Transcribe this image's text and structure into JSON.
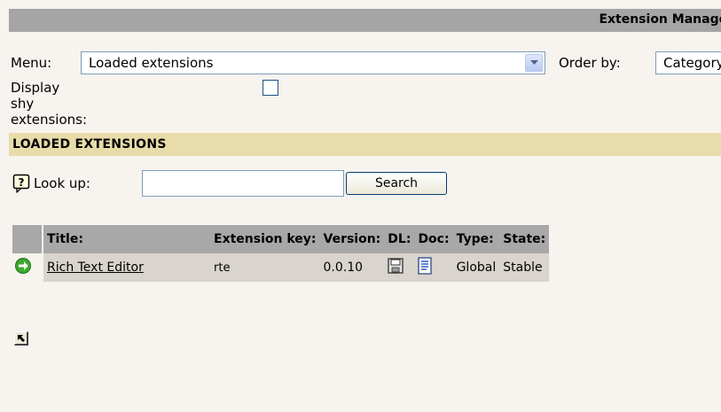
{
  "header": {
    "title": "Extension Manager"
  },
  "menu": {
    "label": "Menu:",
    "selected": "Loaded extensions",
    "order_label": "Order by:",
    "order_selected": "Category"
  },
  "shy": {
    "label": "Display shy extensions:",
    "checked": false
  },
  "section": {
    "title": "LOADED EXTENSIONS"
  },
  "lookup": {
    "label": "Look up:",
    "value": "",
    "search_label": "Search"
  },
  "table": {
    "headers": [
      "Title:",
      "Extension key:",
      "Version:",
      "DL:",
      "Doc:",
      "Type:",
      "State:"
    ],
    "rows": [
      {
        "title": "Rich Text Editor",
        "key": "rte",
        "version": "0.0.10",
        "type": "Global",
        "state": "Stable"
      }
    ]
  },
  "icons": {
    "help": "help-icon",
    "remove": "remove-extension-icon",
    "download": "floppy-disk-icon",
    "doc": "document-icon",
    "goto": "arrow-up-left-icon"
  },
  "colors": {
    "topbar": "#a5a5a5",
    "section_bar": "#e8dcaa",
    "table_head": "#a8a8a8",
    "table_row": "#d9d4cd"
  }
}
